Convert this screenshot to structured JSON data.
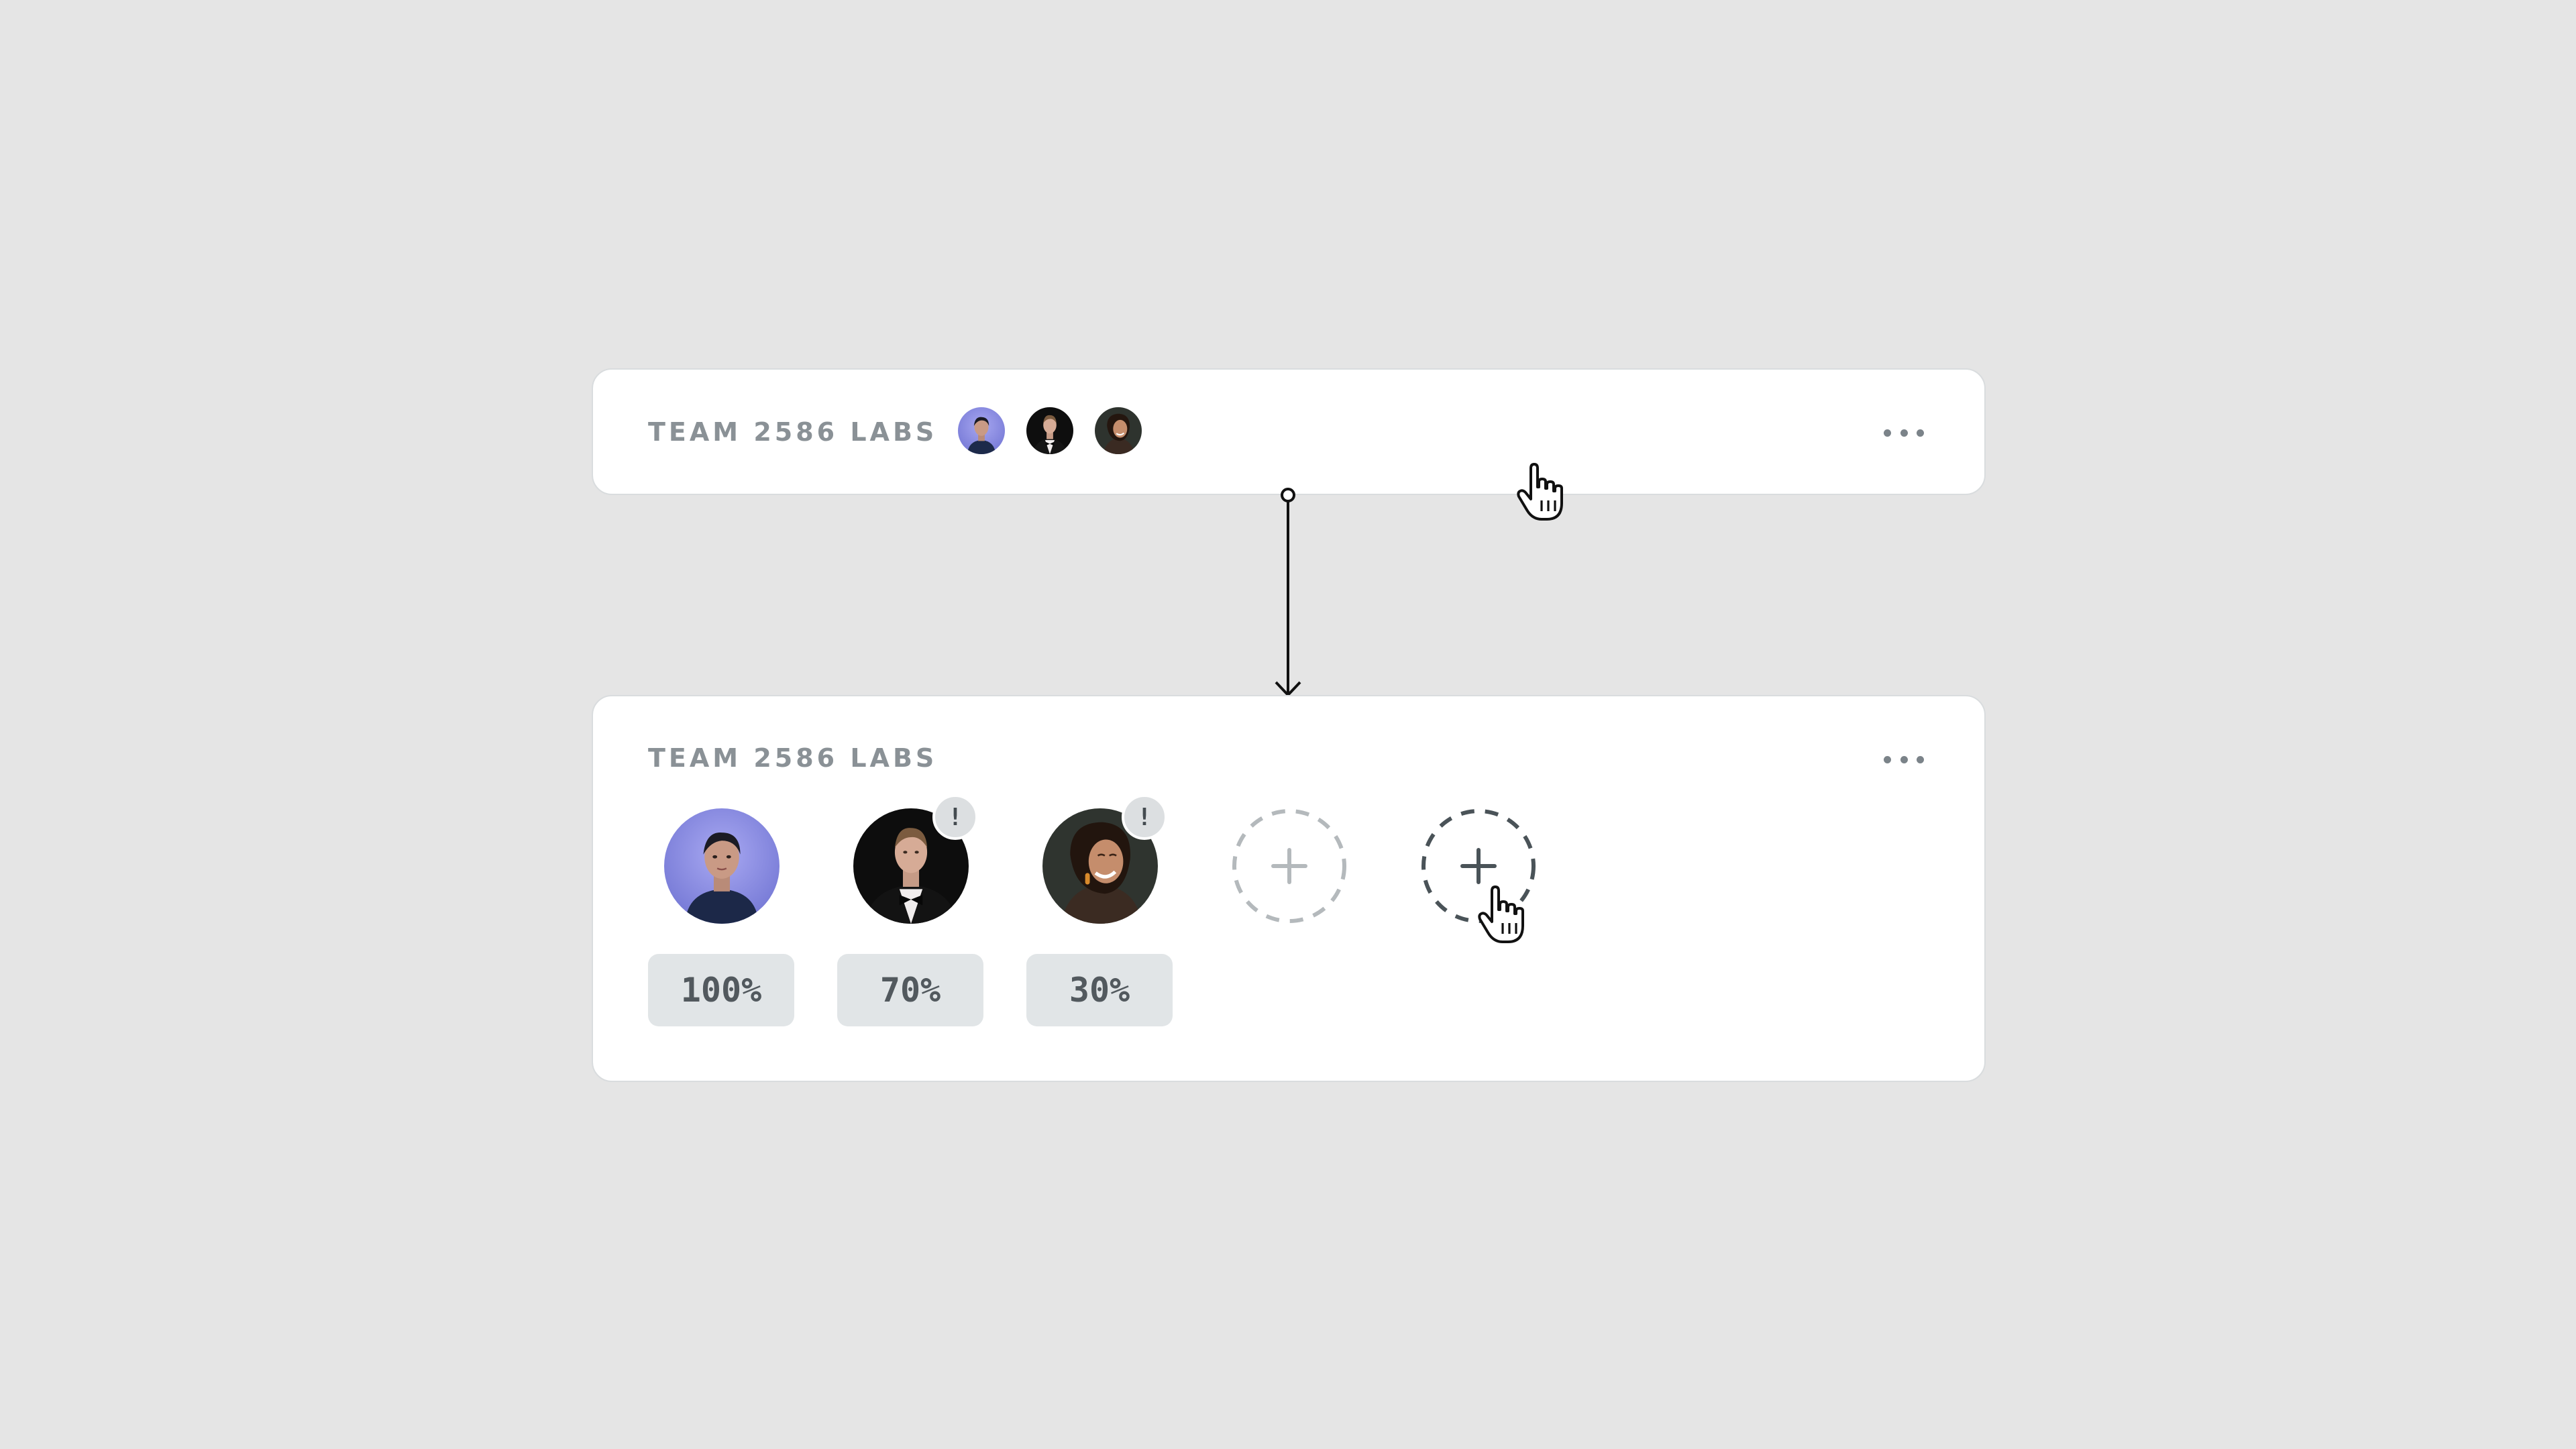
{
  "team": {
    "name": "TEAM 2586 LABS",
    "more_icon": "more-horizontal-icon"
  },
  "members": [
    {
      "avatar": "avatar-woman-blue-portrait",
      "allocation": "100%",
      "warning": false
    },
    {
      "avatar": "avatar-man-tuxedo",
      "allocation": "70%",
      "warning": true,
      "warning_symbol": "!"
    },
    {
      "avatar": "avatar-woman-smiling",
      "allocation": "30%",
      "warning": true,
      "warning_symbol": "!"
    }
  ],
  "add_slots": [
    {
      "state": "default",
      "icon": "plus-icon"
    },
    {
      "state": "hovered",
      "icon": "plus-icon"
    }
  ],
  "colors": {
    "background": "#e5e5e5",
    "card": "#ffffff",
    "title": "#8a9196",
    "pill": "#e1e5e7",
    "pill_text": "#52595e"
  }
}
